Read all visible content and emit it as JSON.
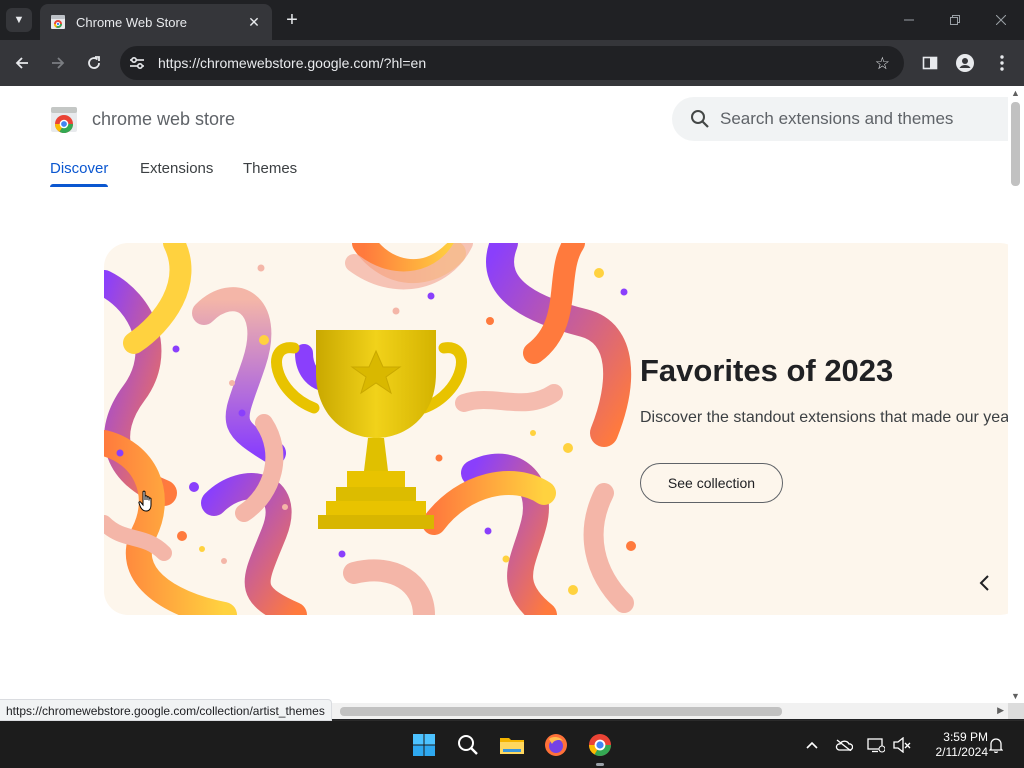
{
  "browser": {
    "tab": {
      "title": "Chrome Web Store"
    },
    "address": {
      "url": "https://chromewebstore.google.com/?hl=en"
    },
    "status_url": "https://chromewebstore.google.com/collection/artist_themes"
  },
  "store": {
    "title": "chrome web store",
    "search": {
      "placeholder": "Search extensions and themes"
    },
    "nav": [
      {
        "label": "Discover",
        "active": true
      },
      {
        "label": "Extensions",
        "active": false
      },
      {
        "label": "Themes",
        "active": false
      }
    ],
    "hero": {
      "title": "Favorites of 2023",
      "description": "Discover the standout extensions that made our year",
      "button": "See collection"
    }
  },
  "taskbar": {
    "apps": [
      "windows-start-icon",
      "search-icon",
      "file-explorer-icon",
      "firefox-icon",
      "chrome-icon"
    ],
    "tray": [
      "chevron-up-icon",
      "onedrive-icon",
      "network-icon",
      "volume-muted-icon"
    ],
    "time": "3:59 PM",
    "date": "2/11/2024"
  },
  "colors": {
    "accent": "#0b57d0",
    "hero_bg": "#fdf6ec",
    "trophy": "#e8c300",
    "ribbon_purple": "#8a3ffc",
    "ribbon_orange": "#ff7a3d",
    "ribbon_yellow": "#ffd23f",
    "ribbon_pink": "#f4b6a8"
  }
}
